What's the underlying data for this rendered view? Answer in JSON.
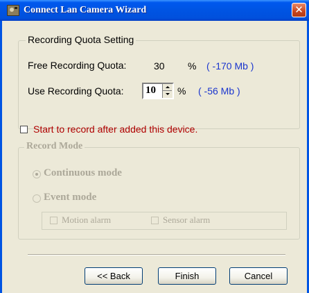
{
  "window": {
    "title": "Connect Lan Camera Wizard",
    "close_glyph": "✕",
    "icon": "camera-app-icon"
  },
  "quota": {
    "legend": "Recording Quota Setting",
    "free_label": "Free Recording Quota:",
    "free_value": "30",
    "free_unit": "%",
    "free_mb": "( -170 Mb )",
    "use_label": "Use Recording Quota:",
    "use_value": "10",
    "use_unit": "%",
    "use_mb": "( -56 Mb )"
  },
  "start_record": {
    "label": "Start to record after added this device.",
    "checked": false
  },
  "record_mode": {
    "legend": "Record Mode",
    "continuous_label": "Continuous mode",
    "event_label": "Event mode",
    "motion_label": "Motion alarm",
    "sensor_label": "Sensor alarm",
    "selected": "Continuous mode"
  },
  "buttons": {
    "back": "<< Back",
    "finish": "Finish",
    "cancel": "Cancel"
  },
  "colors": {
    "titlebar": "#0054E3",
    "background": "#ECE9D8",
    "mb_text": "#1A35CE",
    "start_record_text": "#B00000",
    "disabled_text": "#ACA899"
  }
}
